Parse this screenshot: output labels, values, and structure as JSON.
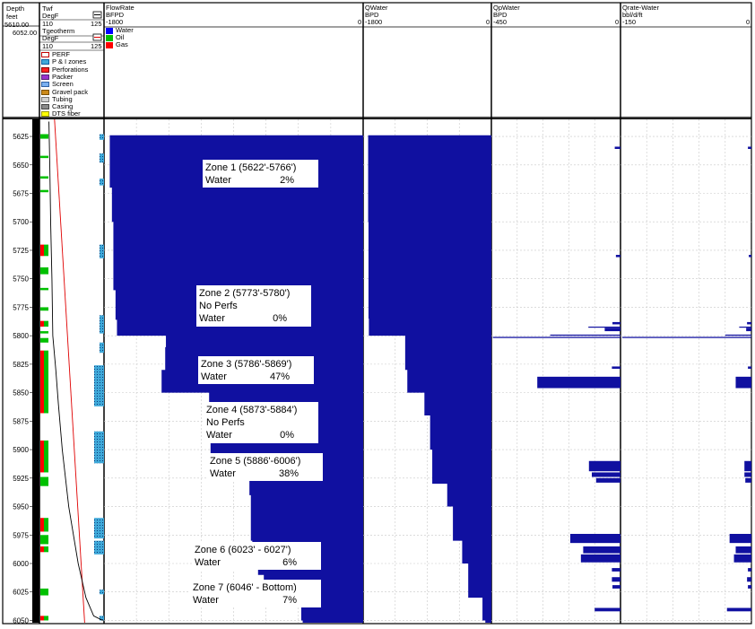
{
  "depth_track": {
    "label": "Depth",
    "unit": "feet",
    "top": "5610.00",
    "bottom": "6052.00"
  },
  "temp_track": {
    "curve1": {
      "name": "Twf",
      "unit": "DegF",
      "min": "110",
      "max": "125"
    },
    "curve2": {
      "name": "Tgeotherm",
      "unit": "DegF",
      "min": "110",
      "max": "125"
    },
    "legend": [
      {
        "label": "PERF",
        "color": "#ffffff",
        "border": "#c00000"
      },
      {
        "label": "P & I zones",
        "color": "#3fa9d9",
        "border": "#1060a0"
      },
      {
        "label": "Perforations",
        "color": "#ff2020",
        "border": "#800000"
      },
      {
        "label": "Packer",
        "color": "#9933cc",
        "border": "#552277"
      },
      {
        "label": "Screen",
        "color": "#7ab0f0",
        "border": "#3060a0"
      },
      {
        "label": "Gravel pack",
        "color": "#cc8a1a",
        "border": "#7a4f00"
      },
      {
        "label": "Tubing",
        "color": "#cfcfcf",
        "border": "#777777"
      },
      {
        "label": "Casing",
        "color": "#8a8a8a",
        "border": "#444444"
      },
      {
        "label": "DTS fiber",
        "color": "#ffff00",
        "border": "#999900"
      }
    ]
  },
  "tracks": [
    {
      "name": "FlowRate",
      "unit": "BFPD",
      "min": "-1800",
      "max": "0",
      "legend": [
        {
          "label": "Water",
          "color": "#0000ff"
        },
        {
          "label": "Oil",
          "color": "#00c000"
        },
        {
          "label": "Gas",
          "color": "#ff0000"
        }
      ]
    },
    {
      "name": "QWater",
      "unit": "BPD",
      "min": "-1800",
      "max": "0"
    },
    {
      "name": "QpWater",
      "unit": "BPD",
      "min": "-450",
      "max": "0"
    },
    {
      "name": "Qrate-Water",
      "unit": "bbl/d/ft",
      "min": "-150",
      "max": "0"
    }
  ],
  "zones": [
    {
      "title": "Zone 1  (5622'-5766')",
      "note": "",
      "fluid": "Water",
      "pct": "2%"
    },
    {
      "title": "Zone 2 (5773'-5780')",
      "note": "No Perfs",
      "fluid": "Water",
      "pct": "0%"
    },
    {
      "title": "Zone 3  (5786'-5869')",
      "note": "",
      "fluid": "Water",
      "pct": "47%"
    },
    {
      "title": "Zone 4 (5873'-5884')",
      "note": "No Perfs",
      "fluid": "Water",
      "pct": "0%"
    },
    {
      "title": "Zone 5 (5886'-6006')",
      "note": "",
      "fluid": "Water",
      "pct": "38%"
    },
    {
      "title": "Zone 6  (6023' - 6027')",
      "note": "",
      "fluid": "Water",
      "pct": "6%"
    },
    {
      "title": "Zone 7  (6046' - Bottom)",
      "note": "",
      "fluid": "Water",
      "pct": "7%"
    }
  ],
  "colors": {
    "flow": "#1010a0",
    "water_legend": "#0000ff",
    "oil": "#00c000",
    "gas": "#ff0000",
    "pi_zone": "#3fa9d9",
    "tgeo": "#e00000",
    "twf": "#000000"
  },
  "chart_data": {
    "type": "area",
    "depth_axis": {
      "label": "Depth",
      "unit": "feet",
      "range": [
        5610,
        6052
      ],
      "ticks": [
        5625,
        5650,
        5675,
        5700,
        5725,
        5750,
        5775,
        5800,
        5825,
        5850,
        5875,
        5900,
        5925,
        5950,
        5975,
        6000,
        6025,
        6050
      ]
    },
    "twf": {
      "depth": [
        5612,
        5650,
        5700,
        5750,
        5800,
        5830,
        5860,
        5900,
        5950,
        6000,
        6030,
        6046,
        6050
      ],
      "value": [
        112.2,
        112.4,
        112.6,
        112.9,
        113.1,
        113.8,
        114.4,
        115.3,
        116.8,
        119.0,
        120.8,
        122.6,
        124.7
      ]
    },
    "tgeotherm": {
      "depth": [
        5610,
        6052
      ],
      "value": [
        113.5,
        120.5
      ]
    },
    "flowrate": {
      "depth": [
        5624,
        5670,
        5700,
        5760,
        5786,
        5800,
        5810,
        5830,
        5850,
        5890,
        5905,
        5920,
        5940,
        5980,
        5990,
        6010,
        6020,
        6030,
        6050
      ],
      "value": [
        -1760,
        -1745,
        -1735,
        -1720,
        -1710,
        -1370,
        -1375,
        -1400,
        -1070,
        -1060,
        -985,
        -790,
        -780,
        -770,
        -730,
        -690,
        -620,
        -430,
        -420
      ]
    },
    "qwater": {
      "depth": [
        5624,
        5700,
        5785,
        5800,
        5830,
        5850,
        5870,
        5900,
        5930,
        5950,
        5980,
        6000,
        6030,
        6050
      ],
      "value": [
        -1730,
        -1725,
        -1720,
        -1210,
        -1180,
        -940,
        -860,
        -830,
        -620,
        -540,
        -410,
        -325,
        -125,
        -85
      ]
    },
    "qpwater": {
      "depth": [
        5634,
        5729,
        5788,
        5792,
        5793,
        5799,
        5801,
        5827,
        5836,
        5910,
        5920,
        5925,
        5974,
        5985,
        5992,
        6004,
        6012,
        6019,
        6039
      ],
      "value": [
        -20,
        -16,
        -28,
        -112,
        -55,
        -245,
        -445,
        -30,
        -290,
        -110,
        -100,
        -85,
        -175,
        -130,
        -138,
        -30,
        -30,
        -28,
        -90
      ]
    },
    "qrate_water": {
      "depth": [
        5634,
        5729,
        5788,
        5792,
        5793,
        5799,
        5801,
        5827,
        5836,
        5910,
        5920,
        5925,
        5974,
        5985,
        5992,
        6004,
        6012,
        6019,
        6039
      ],
      "value": [
        -4,
        -3,
        -5,
        -14,
        -6,
        -30,
        -148,
        -4,
        -18,
        -8,
        -8,
        -7,
        -25,
        -18,
        -20,
        -4,
        -5,
        -4,
        -28
      ]
    }
  }
}
